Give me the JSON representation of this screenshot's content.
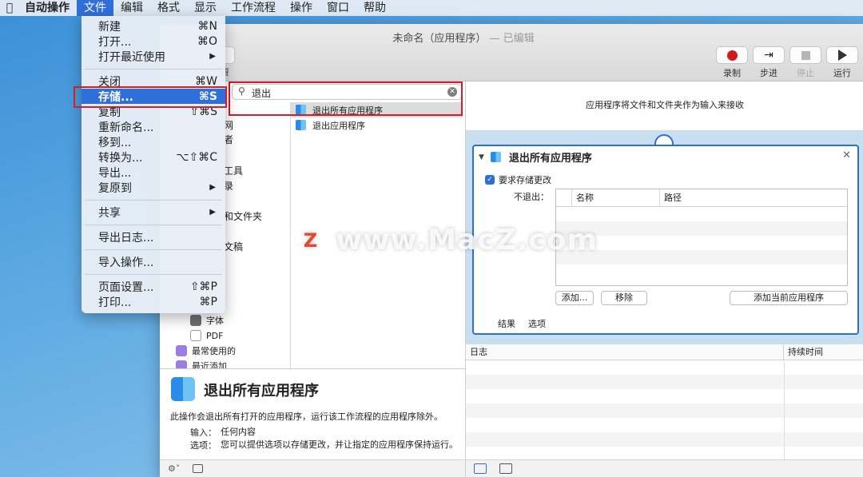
{
  "menubar": {
    "apple_icon": "apple-logo-icon",
    "items": [
      "自动操作",
      "文件",
      "编辑",
      "格式",
      "显示",
      "工作流程",
      "操作",
      "窗口",
      "帮助"
    ]
  },
  "file_menu": {
    "items": [
      {
        "label": "新建",
        "shortcut": "⌘N"
      },
      {
        "label": "打开...",
        "shortcut": "⌘O"
      },
      {
        "label": "打开最近使用",
        "submenu": "▶"
      },
      {
        "label": "关闭",
        "shortcut": "⌘W"
      },
      {
        "label": "存储...",
        "shortcut": "⌘S"
      },
      {
        "label": "复制",
        "shortcut": "⇧⌘S"
      },
      {
        "label": "重新命名..."
      },
      {
        "label": "移到..."
      },
      {
        "label": "转换为...",
        "shortcut": "⌥⇧⌘C"
      },
      {
        "label": "导出..."
      },
      {
        "label": "复原到",
        "submenu": "▶"
      },
      {
        "label": "共享",
        "submenu": "▶"
      },
      {
        "label": "导出日志..."
      },
      {
        "label": "导入操作..."
      },
      {
        "label": "页面设置...",
        "shortcut": "⇧⌘P"
      },
      {
        "label": "打印...",
        "shortcut": "⌘P"
      }
    ],
    "highlight_color": "#2f6fd8"
  },
  "window": {
    "title": "未命名（应用程序）",
    "edited": " — 已编辑",
    "library_label": "資"
  },
  "toolbar": {
    "record": "录制",
    "step": "步进",
    "stop": "停止",
    "run": "运行"
  },
  "search": {
    "value": "退出",
    "icon": "search-icon",
    "clear_icon": "clear-icon"
  },
  "categories_fragments": [
    "网",
    "者",
    "工具",
    "录",
    "和文件夹",
    "文稿"
  ],
  "categories_items": [
    {
      "label": "字体",
      "icon": "font-icon"
    },
    {
      "label": "PDF",
      "icon": "pdf-icon"
    },
    {
      "label": "最常使用的",
      "icon": "folder-icon"
    },
    {
      "label": "最近添加",
      "icon": "folder-icon"
    }
  ],
  "actions": [
    {
      "label": "退出所有应用程序",
      "selected": true
    },
    {
      "label": "退出应用程序",
      "selected": false
    }
  ],
  "description": {
    "title": "退出所有应用程序",
    "text": "此操作会退出所有打开的应用程序，运行该工作流程的应用程序除外。",
    "input_key": "输入：",
    "input_val": "任何内容",
    "options_key": "选项：",
    "options_val": "您可以提供选项以存储更改，并让指定的应用程序保持运行。"
  },
  "workflow": {
    "receive_text": "应用程序将文件和文件夹作为输入来接收",
    "card_title": "退出所有应用程序",
    "checkbox_label": "要求存储更改",
    "noquit_label": "不退出：",
    "col_name": "名称",
    "col_path": "路径",
    "btn_add": "添加...",
    "btn_remove": "移除",
    "btn_add_current": "添加当前应用程序",
    "tab_results": "结果",
    "tab_options": "选项"
  },
  "log": {
    "col_log": "日志",
    "col_duration": "持续时间"
  },
  "watermark": {
    "logo": "Z",
    "text": "www.MacZ.com"
  },
  "colors": {
    "accent": "#2f6fd8",
    "annotation_red": "#d21d2a",
    "record_red": "#d11a1a"
  }
}
